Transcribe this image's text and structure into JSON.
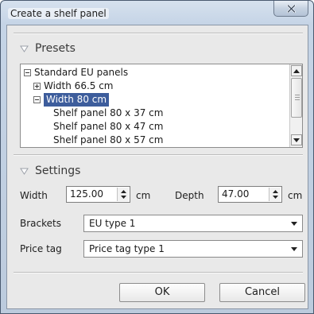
{
  "window": {
    "title": "Create a shelf panel",
    "close_icon": "close-icon"
  },
  "presets": {
    "header": "Presets",
    "tree": [
      {
        "label": "Standard EU panels",
        "level": 0,
        "expander": "minus"
      },
      {
        "label": "Width 66.5 cm",
        "level": 1,
        "expander": "plus"
      },
      {
        "label": "Width 80 cm",
        "level": 1,
        "expander": "minus",
        "selected": true
      },
      {
        "label": "Shelf panel 80 x 37 cm",
        "level": 2
      },
      {
        "label": "Shelf panel 80 x 47 cm",
        "level": 2
      },
      {
        "label": "Shelf panel 80 x 57 cm",
        "level": 2
      }
    ]
  },
  "settings": {
    "header": "Settings",
    "width_label": "Width",
    "width_value": "125.00",
    "width_unit": "cm",
    "depth_label": "Depth",
    "depth_value": "47.00",
    "depth_unit": "cm",
    "brackets_label": "Brackets",
    "brackets_value": "EU type 1",
    "price_tag_label": "Price tag",
    "price_tag_value": "Price tag type 1"
  },
  "buttons": {
    "ok": "OK",
    "cancel": "Cancel"
  },
  "colors": {
    "selection": "#3d5d9c",
    "client_bg": "#e9e9e9"
  }
}
